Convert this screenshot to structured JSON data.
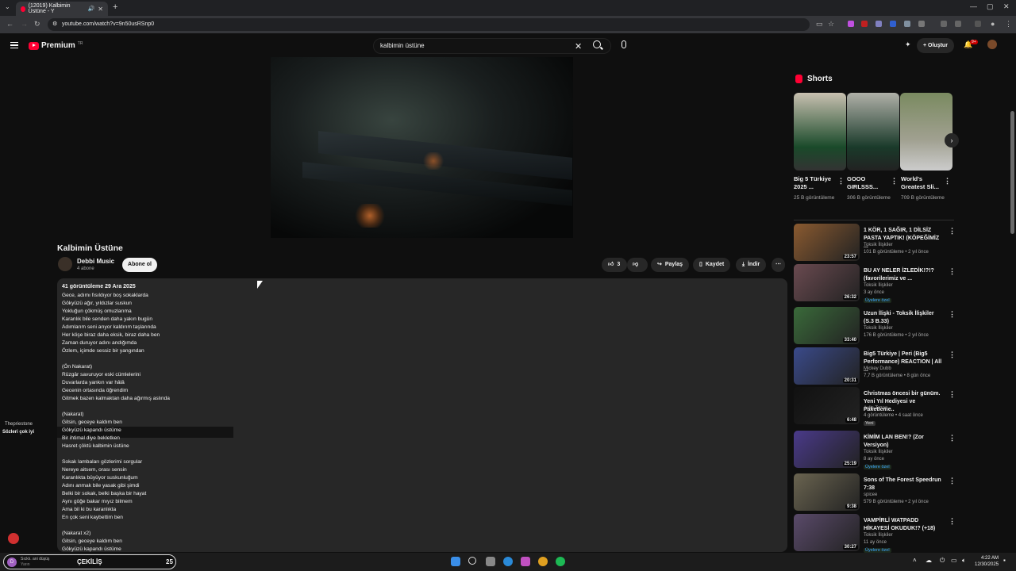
{
  "browser": {
    "tab_title": "(12019) Kalbimin Üstüne - Y",
    "url": "youtube.com/watch?v=9n50usRSnp0"
  },
  "header": {
    "logo_text": "Premium",
    "logo_region": "TR",
    "search_value": "kalbimin üstüne",
    "create_label": "Oluştur",
    "notif_count": "9+"
  },
  "video": {
    "title": "Kalbimin Üstüne",
    "channel": "Debbi Music",
    "subscribers": "4 abone",
    "subscribe_label": "Abone ol",
    "likes": "3",
    "share_label": "Paylaş",
    "save_label": "Kaydet",
    "download_label": "İndir"
  },
  "description": {
    "meta": "41 görüntüleme  29 Ara 2025",
    "lyrics": [
      "Gece, adımı fısıldıyor boş sokaklarda",
      "Gökyüzü ağır, yıldızlar suskun",
      "Yokluğun çökmüş omuzlarıma",
      "Karanlık bile senden daha yakın bugün",
      "Adımlarım seni arıyor kaldırım taşlarında",
      "Her köşe biraz daha eksik, biraz daha ben",
      "Zaman duruyor adını andığımda",
      "Özlem, içimde sessiz bir yangından",
      "",
      "(Ön Nakarat)",
      "Rüzgâr savuruyor eski cümlelerini",
      "Duvarlarda yankın var hâlâ",
      "Gecenin ortasında öğrendim",
      "Gitmek bazen kalmaktan daha ağırmış aslında",
      "",
      "(Nakarat)",
      "Gitsin, geceye kaldım ben",
      "Gökyüzü kapandı üstüme",
      "Bir ihtimal diye bekletken",
      "Hasret çöktü kalbimin üstüne",
      "",
      "Sokak lambaları gözlerimi sorgular",
      "Nereye aitsem, orası sensin",
      "Karanlıkta büyüyor suskunluğum",
      "Adını anmak bile yasak gibi şimdi",
      "Belki bir sokak, belki başka bir hayat",
      "Aynı göğe bakar mıyız bilmem",
      "Ama bil ki bu karanlıkta",
      "En çok seni kaybettim ben",
      "",
      "(Nakarat x2)",
      "Gitsin, geceye kaldım ben",
      "Gökyüzü kapandı üstüme"
    ]
  },
  "shorts": {
    "heading": "Shorts",
    "items": [
      {
        "title": "Big 5 Türkiye 2025 ...",
        "views": "25 B görüntüleme"
      },
      {
        "title": "GOOO GIRLSSS...",
        "views": "306 B görüntüleme"
      },
      {
        "title": "World's Greatest Sli...",
        "views": "709 B görüntüleme"
      }
    ]
  },
  "recommendations": [
    {
      "title": "1 KÖR, 1 SAĞIR, 1 DİLSİZ PASTA YAPTIK! (KÖPEĞİMİZ ...",
      "channel": "Toksik İlişkiler",
      "meta": "101 B görüntüleme • 2 yıl önce",
      "duration": "23:57",
      "badge": "",
      "color": "#8a5a30"
    },
    {
      "title": "BU AY NELER İZLEDİK!?!? (favorilerimiz ve ...",
      "channel": "Toksik İlişkiler",
      "meta": "3 ay önce",
      "duration": "26:32",
      "badge": "Üyelere özel",
      "color": "#6a4a50"
    },
    {
      "title": "Uzun İlişki - Toksik İlişkiler (S.3 B.33)",
      "channel": "Toksik İlişkiler",
      "meta": "176 B görüntüleme • 2 yıl önce",
      "duration": "33:40",
      "badge": "",
      "color": "#3a6a3a"
    },
    {
      "title": "Big5 Türkiye | Peri (Big5 Performance) REACTION | All ...",
      "channel": "Mickey Dubb",
      "meta": "7,7 B görüntüleme • 8 gün önce",
      "duration": "20:31",
      "badge": "",
      "color": "#3a4a8a"
    },
    {
      "title": "Christmas öncesi bir günüm. Yeni Yıl Hediyesi ve Paketleme..",
      "channel": "Aylin Tozan",
      "meta": "4 görüntüleme • 4 saat önce",
      "duration": "6:48",
      "badge": "Yeni",
      "color": "#111111"
    },
    {
      "title": "KİMİM LAN BEN!? (Zor Versiyon)",
      "channel": "Toksik İlişkiler",
      "meta": "8 ay önce",
      "duration": "25:19",
      "badge": "Üyelere özel",
      "color": "#4a3a8a"
    },
    {
      "title": "Sons of The Forest Speedrun 7:38",
      "channel": "spicee",
      "meta": "579 B görüntüleme • 2 yıl önce",
      "duration": "9:38",
      "badge": "",
      "color": "#6a6450"
    },
    {
      "title": "VAMPİRLİ WATPADD HİKAYESİ OKUDUK!? (+18)",
      "channel": "Toksik İlişkiler",
      "meta": "11 ay önce",
      "duration": "30:27",
      "badge": "Üyelere özel",
      "color": "#5a4a6a"
    }
  ],
  "overlay": {
    "user": "Thepriestone",
    "message": "Sözleri çok iyi"
  },
  "taskbar": {
    "widget_line1": "Sıcklı. ani düşüş",
    "widget_line2": "Yarın",
    "widget_title": "ÇEKİLİŞ",
    "widget_count": "25",
    "time": "4:22 AM",
    "date": "12/30/2025"
  }
}
